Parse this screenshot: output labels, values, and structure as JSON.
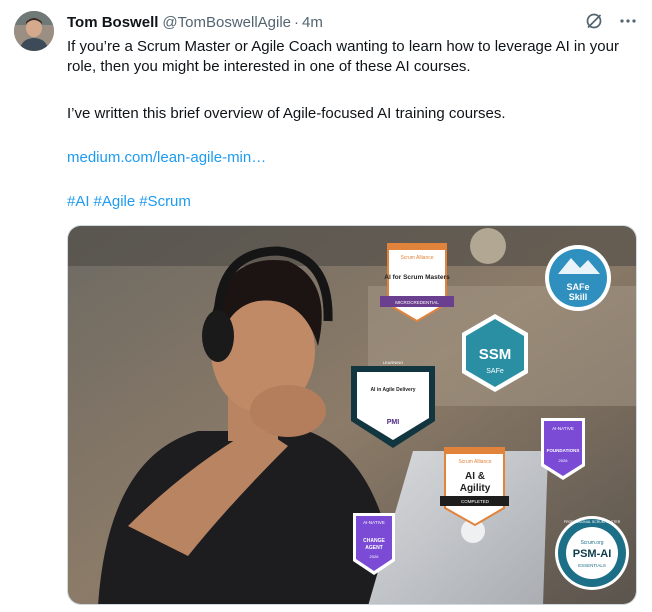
{
  "tweet": {
    "display_name": "Tom Boswell",
    "handle": "@TomBoswellAgile",
    "separator": "·",
    "time": "4m",
    "text_line1": "If you’re a Scrum Master or Agile Coach wanting to learn how to leverage AI in your role, then you might be interested in one of these AI courses.",
    "text_line2": "I’ve written this brief overview of Agile-focused AI training courses.",
    "link": "medium.com/lean-agile-min…",
    "hashtags": [
      "#AI",
      "#Agile",
      "#Scrum"
    ]
  },
  "icons": {
    "grok": "grok-icon",
    "more": "more-icon"
  },
  "badges": {
    "scrum_alliance_ai_sm": {
      "brand": "Scrum Alliance",
      "title": "AI for Scrum Masters",
      "ribbon": "MICROCREDENTIAL"
    },
    "safe_skill": {
      "line1": "SAFe",
      "line2": "Skill"
    },
    "ssm": {
      "title": "SSM",
      "sub": "SAFe"
    },
    "pmi": {
      "top": "LEARNING",
      "title": "AI in Agile Delivery",
      "brand": "PMI"
    },
    "ai_native_foundations": {
      "top": "AI-NATIVE",
      "title": "FOUNDATIONS",
      "year": "2026"
    },
    "scrum_alliance_ai_agility": {
      "brand": "Scrum Alliance",
      "title1": "AI &",
      "title2": "Agility",
      "ribbon": "COMPLETED"
    },
    "ai_native_change_agent": {
      "top": "AI-NATIVE",
      "title1": "CHANGE",
      "title2": "AGENT",
      "year": "2026"
    },
    "psm_ai": {
      "brand": "Scrum.org",
      "title": "PSM-AI",
      "sub": "ESSENTIALS",
      "ring": "PROFESSIONAL SCRUM MASTER"
    }
  },
  "colors": {
    "link_blue": "#1d9bf0",
    "muted": "#536471",
    "text": "#0f1419"
  }
}
